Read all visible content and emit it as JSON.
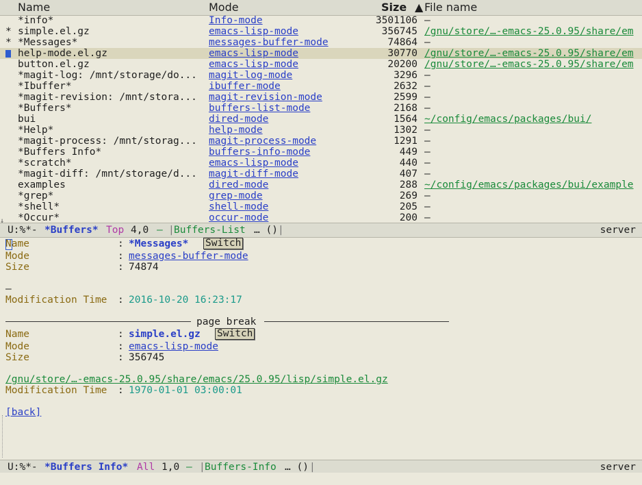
{
  "header": {
    "name": "Name",
    "mode": "Mode",
    "size": "Size",
    "sort_arrow": "▲",
    "file_name": "File name"
  },
  "buffers": [
    {
      "mark": "",
      "name": "*info*",
      "mode": "Info-mode",
      "size": "3501106",
      "file": "–"
    },
    {
      "mark": "*",
      "name": "simple.el.gz",
      "mode": "emacs-lisp-mode",
      "size": "356745",
      "file": "/gnu/store/…-emacs-25.0.95/share/em"
    },
    {
      "mark": "*",
      "name": "*Messages*",
      "mode": "messages-buffer-mode",
      "size": "74864",
      "file": "–"
    },
    {
      "mark": "",
      "name": "help-mode.el.gz",
      "mode": "emacs-lisp-mode",
      "size": "30770",
      "file": "/gnu/store/…-emacs-25.0.95/share/em"
    },
    {
      "mark": "",
      "name": "button.el.gz",
      "mode": "emacs-lisp-mode",
      "size": "20200",
      "file": "/gnu/store/…-emacs-25.0.95/share/em"
    },
    {
      "mark": "",
      "name": "*magit-log: /mnt/storage/do...",
      "mode": "magit-log-mode",
      "size": "3296",
      "file": "–"
    },
    {
      "mark": "",
      "name": "*Ibuffer*",
      "mode": "ibuffer-mode",
      "size": "2632",
      "file": "–"
    },
    {
      "mark": "",
      "name": "*magit-revision: /mnt/stora...",
      "mode": "magit-revision-mode",
      "size": "2599",
      "file": "–"
    },
    {
      "mark": "",
      "name": "*Buffers*",
      "mode": "buffers-list-mode",
      "size": "2168",
      "file": "–"
    },
    {
      "mark": "",
      "name": "bui",
      "mode": "dired-mode",
      "size": "1564",
      "file": "~/config/emacs/packages/bui/"
    },
    {
      "mark": "",
      "name": "*Help*",
      "mode": "help-mode",
      "size": "1302",
      "file": "–"
    },
    {
      "mark": "",
      "name": "*magit-process: /mnt/storag...",
      "mode": "magit-process-mode",
      "size": "1291",
      "file": "–"
    },
    {
      "mark": "",
      "name": "*Buffers Info*",
      "mode": "buffers-info-mode",
      "size": "449",
      "file": "–"
    },
    {
      "mark": "",
      "name": "*scratch*",
      "mode": "emacs-lisp-mode",
      "size": "440",
      "file": "–"
    },
    {
      "mark": "",
      "name": "*magit-diff: /mnt/storage/d...",
      "mode": "magit-diff-mode",
      "size": "407",
      "file": "–"
    },
    {
      "mark": "",
      "name": "examples",
      "mode": "dired-mode",
      "size": "288",
      "file": "~/config/emacs/packages/bui/example"
    },
    {
      "mark": "",
      "name": "*grep*",
      "mode": "grep-mode",
      "size": "269",
      "file": "–"
    },
    {
      "mark": "",
      "name": "*shell*",
      "mode": "shell-mode",
      "size": "205",
      "file": "–"
    },
    {
      "mark": "",
      "name": "*Occur*",
      "mode": "occur-mode",
      "size": "200",
      "file": "–"
    }
  ],
  "modeline_top": {
    "state": "U:%*-",
    "buffer": "*Buffers*",
    "position": "Top",
    "line_col": "4,0",
    "dash": "–",
    "major": "Buffers-List",
    "minor": "… ()",
    "server": "server"
  },
  "info": {
    "entry1": {
      "name_label": "Name",
      "name_value": "*Messages*",
      "switch": "Switch",
      "mode_label": "Mode",
      "mode_value": "messages-buffer-mode",
      "size_label": "Size",
      "size_value": "74874",
      "file_value": "–",
      "mtime_label": "Modification Time",
      "mtime_value": "2016-10-20 16:23:17"
    },
    "page_break": "page break",
    "entry2": {
      "name_label": "Name",
      "name_value": "simple.el.gz",
      "switch": "Switch",
      "mode_label": "Mode",
      "mode_value": "emacs-lisp-mode",
      "size_label": "Size",
      "size_value": "356745",
      "file_value": "/gnu/store/…-emacs-25.0.95/share/emacs/25.0.95/lisp/simple.el.gz",
      "mtime_label": "Modification Time",
      "mtime_value": "1970-01-01 03:00:01"
    },
    "sep": ":",
    "back": "[back]"
  },
  "modeline_bottom": {
    "state": "U:%*-",
    "buffer": "*Buffers Info*",
    "position": "All",
    "line_col": "1,0",
    "dash": "–",
    "major": "Buffers-Info",
    "minor": "… ()",
    "server": "server"
  },
  "colors": {
    "background": "#ebe9dc",
    "link_blue": "#2a3fc7",
    "link_green": "#1a8a3a",
    "label_gold": "#8a6a12",
    "timestamp_teal": "#1a9a8a",
    "cursor_blue": "#2e5ccf"
  }
}
